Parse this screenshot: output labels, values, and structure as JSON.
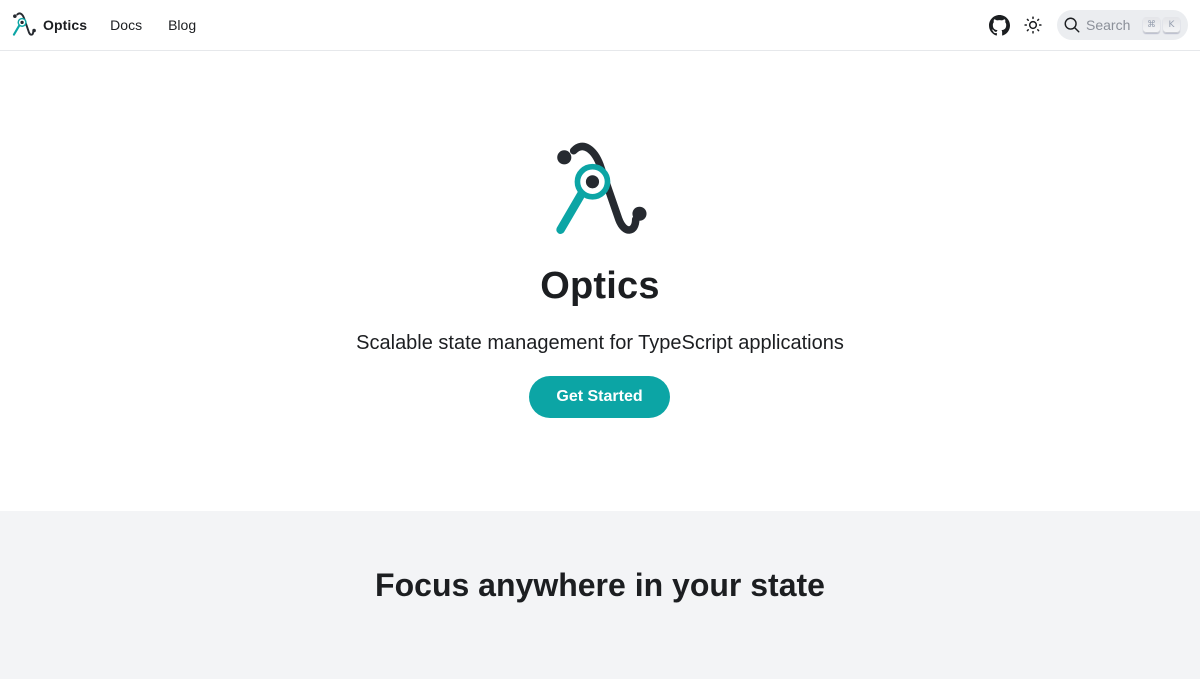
{
  "navbar": {
    "brand": {
      "name": "Optics",
      "logo_icon": "optics-lambda-lens-icon"
    },
    "links": [
      {
        "label": "Docs"
      },
      {
        "label": "Blog"
      }
    ],
    "github_icon": "github-icon",
    "theme_toggle_icon": "sun-icon",
    "search": {
      "label": "Search",
      "icon": "search-icon",
      "shortcut_keys": [
        "⌘",
        "K"
      ]
    }
  },
  "hero": {
    "title": "Optics",
    "tagline": "Scalable state management for TypeScript applications",
    "cta_label": "Get Started"
  },
  "features": {
    "title": "Focus anywhere in your state"
  },
  "colors": {
    "accent": "#0ca5a5",
    "dark": "#262a30",
    "section_bg": "#f3f4f6"
  }
}
